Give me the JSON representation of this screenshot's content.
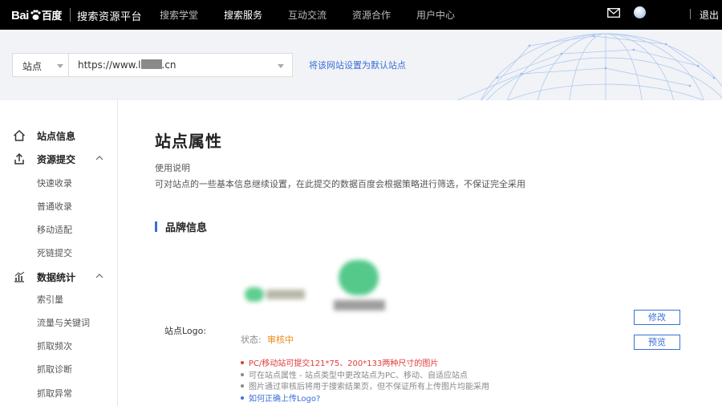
{
  "topbar": {
    "logo_text_1": "Bai",
    "logo_text_2": "百度",
    "brand": "搜索资源平台",
    "nav": [
      {
        "label": "搜索学堂"
      },
      {
        "label": "搜索服务"
      },
      {
        "label": "互动交流"
      },
      {
        "label": "资源合作"
      },
      {
        "label": "用户中心"
      }
    ],
    "logout": "退出",
    "mail_icon": "mail-icon",
    "avatar_icon": "avatar"
  },
  "site_bar": {
    "select_label": "站点",
    "url_prefix": "https://www.l",
    "url_suffix": ".cn",
    "default_link": "将该网站设置为默认站点"
  },
  "sidebar": {
    "site_info": "站点信息",
    "resource_submit": {
      "label": "资源提交",
      "items": [
        "快速收录",
        "普通收录",
        "移动适配",
        "死链提交"
      ]
    },
    "data_stats": {
      "label": "数据统计",
      "items": [
        "索引量",
        "流量与关键词",
        "抓取频次",
        "抓取诊断",
        "抓取异常"
      ]
    }
  },
  "main": {
    "title": "站点属性",
    "usage_title": "使用说明",
    "usage_desc": "可对站点的一些基本信息继续设置，在此提交的数据百度会根据策略进行筛选，不保证完全采用",
    "section_title": "品牌信息",
    "logo_label": "站点Logo:",
    "status_label": "状态:",
    "status_value": "审核中",
    "edit_button": "修改",
    "preview_button": "预览",
    "notes": [
      "PC/移动站可提交121*75、200*133两种尺寸的图片",
      "可在站点属性 - 站点类型中更改站点为PC、移动、自适应站点",
      "图片通过审核后将用于搜索结果页，但不保证所有上传图片均能采用",
      "如何正确上传Logo?"
    ]
  },
  "colors": {
    "accent": "#3a6fd8",
    "status": "#ee8a18",
    "warning": "#e03b3b",
    "topbar": "#000000"
  }
}
